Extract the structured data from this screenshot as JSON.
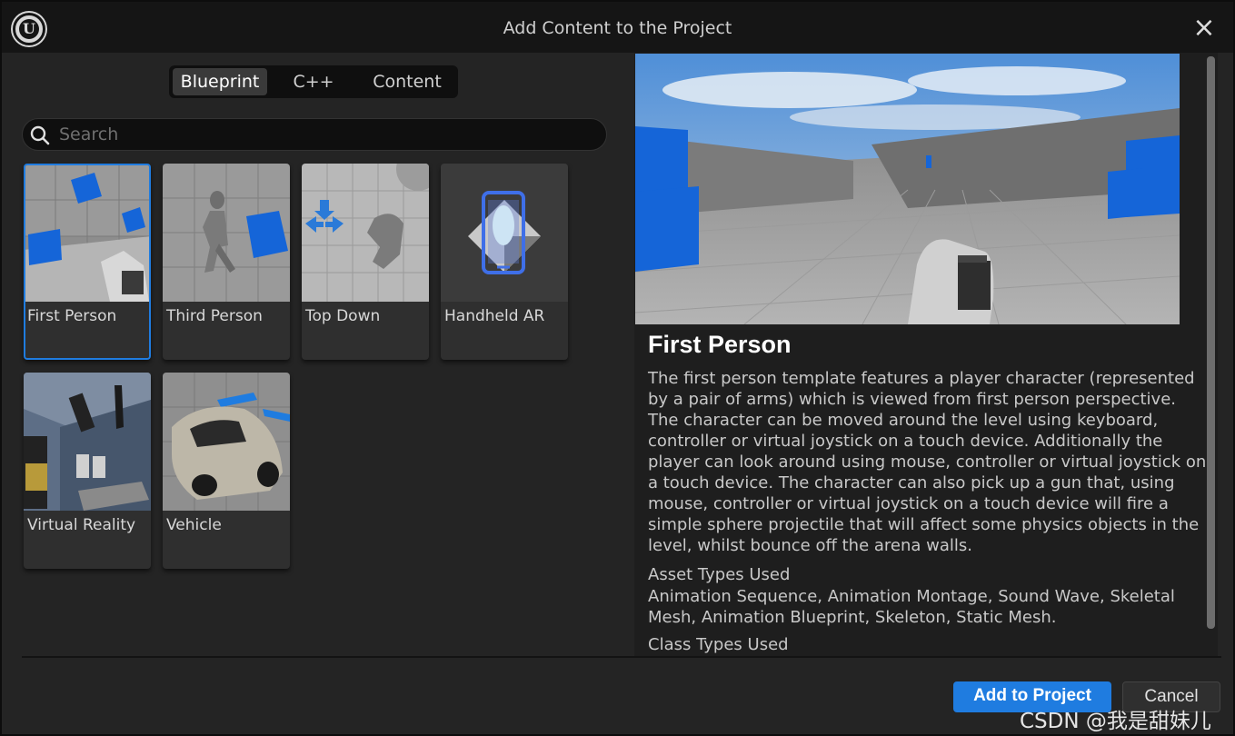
{
  "window": {
    "title": "Add Content to the Project",
    "logo_text": "U"
  },
  "tabs": [
    {
      "label": "Blueprint",
      "active": true
    },
    {
      "label": "C++",
      "active": false
    },
    {
      "label": "Content",
      "active": false
    }
  ],
  "search": {
    "placeholder": "Search",
    "value": ""
  },
  "templates": [
    {
      "label": "First Person",
      "selected": true
    },
    {
      "label": "Third Person",
      "selected": false
    },
    {
      "label": "Top Down",
      "selected": false
    },
    {
      "label": "Handheld AR",
      "selected": false
    },
    {
      "label": "Virtual Reality",
      "selected": false
    },
    {
      "label": "Vehicle",
      "selected": false
    }
  ],
  "details": {
    "title": "First Person",
    "description": "The first person template features a player character (represented by a pair of arms) which is viewed from first person perspective. The character can be moved around the level using keyboard, controller or virtual joystick on a touch device. Additionally the player can look around using mouse, controller or virtual joystick on a touch device. The character can also pick up a gun that, using mouse, controller or virtual joystick on a touch device will fire a simple sphere projectile that will affect some physics objects in the level, whilst bounce off the arena walls.",
    "asset_types_label": "Asset Types Used",
    "asset_types_value": "Animation Sequence, Animation Montage, Sound Wave, Skeletal Mesh, Animation Blueprint, Skeleton, Static Mesh.",
    "class_types_label": "Class Types Used"
  },
  "buttons": {
    "add": "Add to Project",
    "cancel": "Cancel"
  },
  "watermark": "CSDN @我是甜妹儿",
  "colors": {
    "accent": "#1f7ce0",
    "cube_blue": "#1565d8",
    "panel": "#242424"
  }
}
